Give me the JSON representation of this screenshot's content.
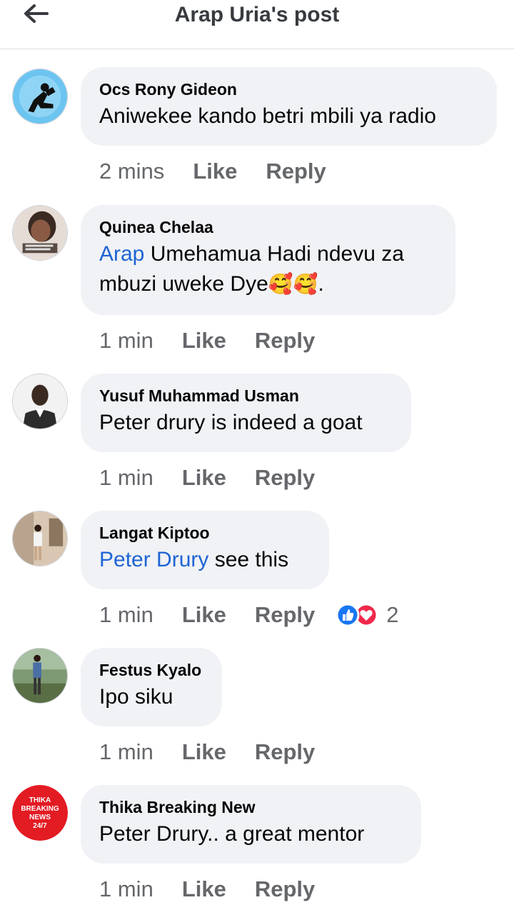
{
  "header": {
    "title": "Arap Uria's post"
  },
  "comments": [
    {
      "author": "Ocs Rony Gideon",
      "text": "Aniwekee kando betri mbili ya radio",
      "time": "2 mins",
      "like": "Like",
      "reply": "Reply"
    },
    {
      "author": "Quinea Chelaa",
      "mention": "Arap",
      "text_line1": " Umehamua Hadi ndevu za",
      "text_line2": "mbuzi uweke Dye",
      "emojis": "🥰🥰",
      "text_end": ".",
      "time": "1 min",
      "like": "Like",
      "reply": "Reply"
    },
    {
      "author": "Yusuf Muhammad Usman",
      "text": "Peter drury is indeed a goat",
      "time": "1 min",
      "like": "Like",
      "reply": "Reply"
    },
    {
      "author": "Langat Kiptoo",
      "mention": "Peter Drury",
      "text": " see this",
      "time": "1 min",
      "like": "Like",
      "reply": "Reply",
      "reaction_count": "2"
    },
    {
      "author": "Festus Kyalo",
      "text": "Ipo siku",
      "time": "1 min",
      "like": "Like",
      "reply": "Reply"
    },
    {
      "author": "Thika Breaking New",
      "text": "Peter Drury..  a great mentor",
      "time": "1 min",
      "like": "Like",
      "reply": "Reply",
      "avatar_text": [
        "THIKA",
        "BREAKING",
        "NEWS",
        "24/7"
      ]
    }
  ],
  "colors": {
    "mention": "#1e64d4",
    "bubble": "#f0f2f5",
    "meta": "#65676b",
    "like_reaction": "#1877f2",
    "love_reaction": "#f0284a"
  }
}
